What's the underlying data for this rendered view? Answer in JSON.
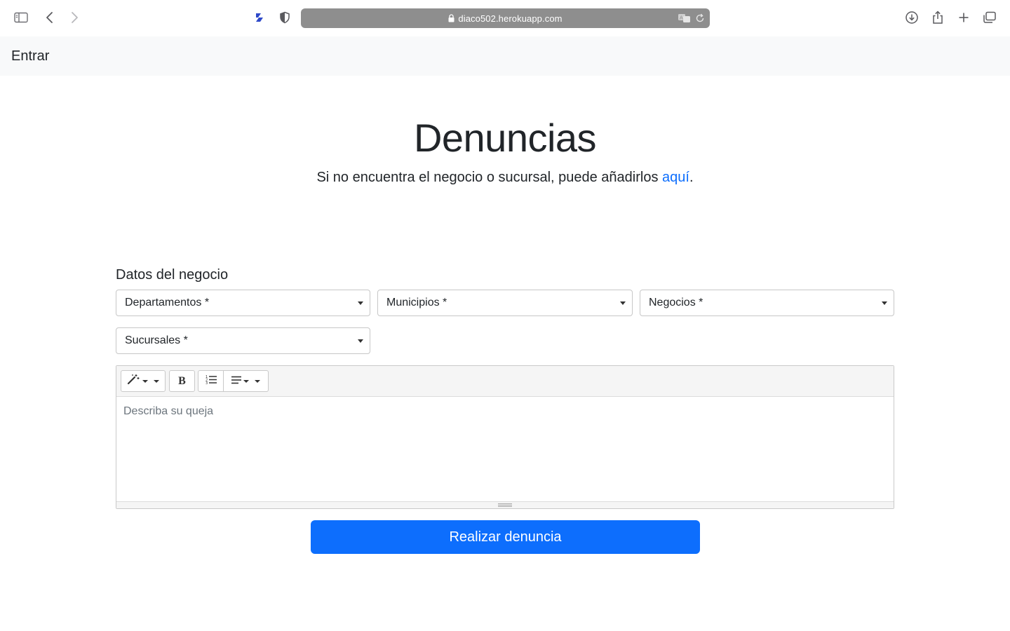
{
  "browser": {
    "url": "diaco502.herokuapp.com",
    "icons": [
      "sidebar-icon",
      "back-icon",
      "forward-icon",
      "extension-icon",
      "shield-icon",
      "lock-icon",
      "translate-icon",
      "reload-icon",
      "download-icon",
      "share-icon",
      "new-tab-icon",
      "tabs-overview-icon"
    ]
  },
  "navbar": {
    "brand": "Entrar"
  },
  "hero": {
    "title": "Denuncias",
    "subtitle_text": "Si no encuentra el negocio o sucursal, puede añadirlos ",
    "subtitle_link": "aquí",
    "subtitle_end": "."
  },
  "form": {
    "section_title": "Datos del negocio",
    "selects": {
      "departamentos": "Departamentos *",
      "municipios": "Municipios *",
      "negocios": "Negocios *",
      "sucursales": "Sucursales *"
    },
    "editor": {
      "placeholder": "Describa su queja",
      "toolbar": [
        "style-magic-icon",
        "bold-icon",
        "ordered-list-icon",
        "paragraph-align-icon"
      ]
    },
    "submit_label": "Realizar denuncia"
  },
  "colors": {
    "primary": "#0d6efd",
    "navbar_bg": "#f8f9fa",
    "url_bar": "#8e8e8e"
  }
}
